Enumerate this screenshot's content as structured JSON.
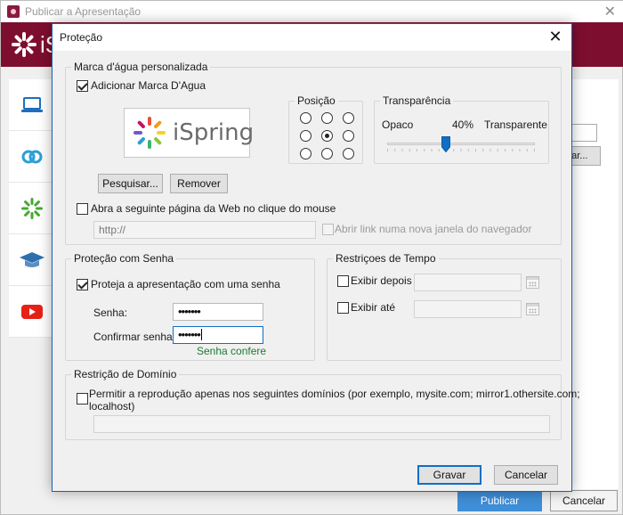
{
  "background_window": {
    "title": "Publicar a Apresentação",
    "brand": "iS",
    "small_button_label": "gar...",
    "publish_label": "Publicar",
    "cancel_label": "Cancelar"
  },
  "dialog": {
    "title": "Proteção",
    "watermark": {
      "group_label": "Marca d'água personalizada",
      "add_label": "Adicionar Marca D'Agua",
      "add_checked": true,
      "logo_text": "iSpring",
      "browse_label": "Pesquisar...",
      "remove_label": "Remover",
      "position": {
        "label": "Posição",
        "selected": "middle-center"
      },
      "transparency": {
        "label": "Transparência",
        "min_label": "Opaco",
        "max_label": "Transparente",
        "value_text": "40%",
        "value": 0.4
      },
      "open_web_label": "Abra a seguinte página da Web no clique do mouse",
      "open_web_checked": false,
      "url_value": "http://",
      "new_window_label": "Abrir link numa nova janela do navegador",
      "new_window_checked": false
    },
    "password": {
      "group_label": "Proteção com Senha",
      "protect_label": "Proteja a apresentação com uma senha",
      "protect_checked": true,
      "password_label": "Senha:",
      "password_value": "•••••••",
      "confirm_label": "Confirmar senha:",
      "confirm_value": "•••••••",
      "match_text": "Senha confere",
      "match_color": "#1e7a32"
    },
    "time": {
      "group_label": "Restriçoes de Tempo",
      "after_label": "Exibir depois",
      "after_checked": false,
      "until_label": "Exibir até",
      "until_checked": false
    },
    "domain": {
      "group_label": "Restrição de Domínio",
      "allow_label_line1": "Permitir a reprodução apenas nos seguintes domínios (por exemplo, mysite.com; mirror1.othersite.com;",
      "allow_label_line2": "localhost)",
      "allow_checked": false
    },
    "save_label": "Gravar",
    "cancel_label": "Cancelar"
  },
  "colors": {
    "brand": "#7e0e2f",
    "accent": "#0f6fc6",
    "publish": "#3f8ed8"
  },
  "icons": [
    "laptop-icon",
    "link-icon",
    "ispring-flower-icon",
    "graduation-cap-icon",
    "youtube-icon",
    "close-icon",
    "calendar-icon"
  ]
}
